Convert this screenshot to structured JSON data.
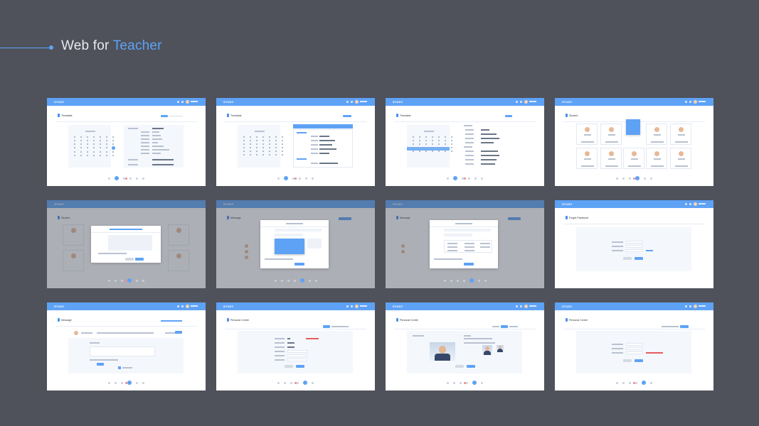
{
  "header": {
    "title_prefix": "Web for ",
    "title_accent": "Teacher"
  },
  "colors": {
    "background": "#4f525b",
    "accent": "#5ea2f5",
    "title": "#e7e9ee"
  },
  "cards": [
    {
      "logo": "STUDY",
      "page_title": "Timetable"
    },
    {
      "logo": "STUDY",
      "page_title": "Timetable"
    },
    {
      "logo": "STUDY",
      "page_title": "Timetable"
    },
    {
      "logo": "STUDY",
      "page_title": "Student"
    },
    {
      "logo": "STUDY",
      "page_title": "Student"
    },
    {
      "logo": "STUDY",
      "page_title": "Message"
    },
    {
      "logo": "STUDY",
      "page_title": "Message"
    },
    {
      "logo": "STUDY",
      "page_title": "Forget Password"
    },
    {
      "logo": "STUDY",
      "page_title": "Message"
    },
    {
      "logo": "STUDY",
      "page_title": "Personal Center"
    },
    {
      "logo": "STUDY",
      "page_title": "Personal Center"
    },
    {
      "logo": "STUDY",
      "page_title": "Personal Center"
    }
  ]
}
